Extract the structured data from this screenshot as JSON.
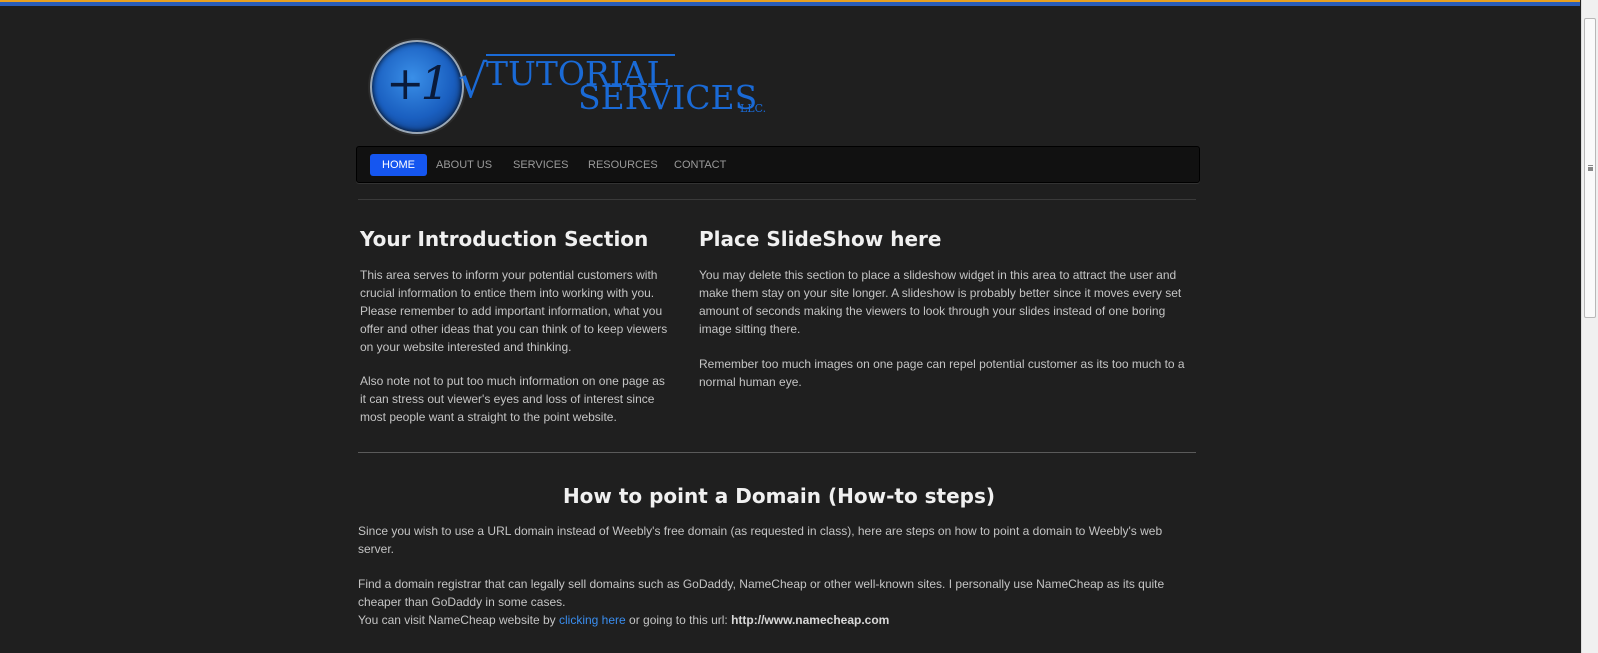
{
  "logo": {
    "mark": "+1",
    "line1": "TUTORIAL",
    "line2": "SERVICES",
    "suffix": "LLC."
  },
  "nav": {
    "items": [
      {
        "label": "HOME",
        "active": true
      },
      {
        "label": "ABOUT US",
        "active": false
      },
      {
        "label": "SERVICES",
        "active": false
      },
      {
        "label": "RESOURCES",
        "active": false
      },
      {
        "label": "CONTACT",
        "active": false
      }
    ]
  },
  "intro": {
    "title": "Your Introduction Section",
    "p1": "This area serves to inform your potential customers with crucial information to entice them into working with you. Please remember to add important information, what you offer and other ideas that you can think of to keep viewers on your website interested and thinking.",
    "p2": "Also note not to put too much information on one page as it can stress out viewer's eyes and loss of interest since most people want a straight to the point website."
  },
  "slideshow": {
    "title": "Place SlideShow here",
    "p1": "You may delete this section to place a slideshow widget in this area to attract the user and make them stay on your site longer. A slideshow is probably better since it moves every set amount of seconds making the viewers to look through your slides instead of one boring image sitting there.",
    "p2": "Remember too much images on one page can repel potential customer as its too much to a normal human eye."
  },
  "howto": {
    "title": "How to point a Domain (How-to steps)",
    "p1": "Since you wish to use a URL domain instead of Weebly's free domain (as requested in class), here are steps on how to point a domain to Weebly's web server.",
    "p2": "Find a domain registrar that can legally sell domains such as GoDaddy, NameCheap or other well-known sites. I personally use NameCheap as its quite cheaper than GoDaddy in some cases.",
    "p3_pre": "You can visit NameCheap website by ",
    "p3_link": "clicking here",
    "p3_mid": " or going to this url: ",
    "p3_url": "http://www.namecheap.com"
  },
  "colors": {
    "background": "#1f1f1f",
    "accent": "#1556f0",
    "brand": "#1a6ad6",
    "link": "#3a8ef0"
  }
}
